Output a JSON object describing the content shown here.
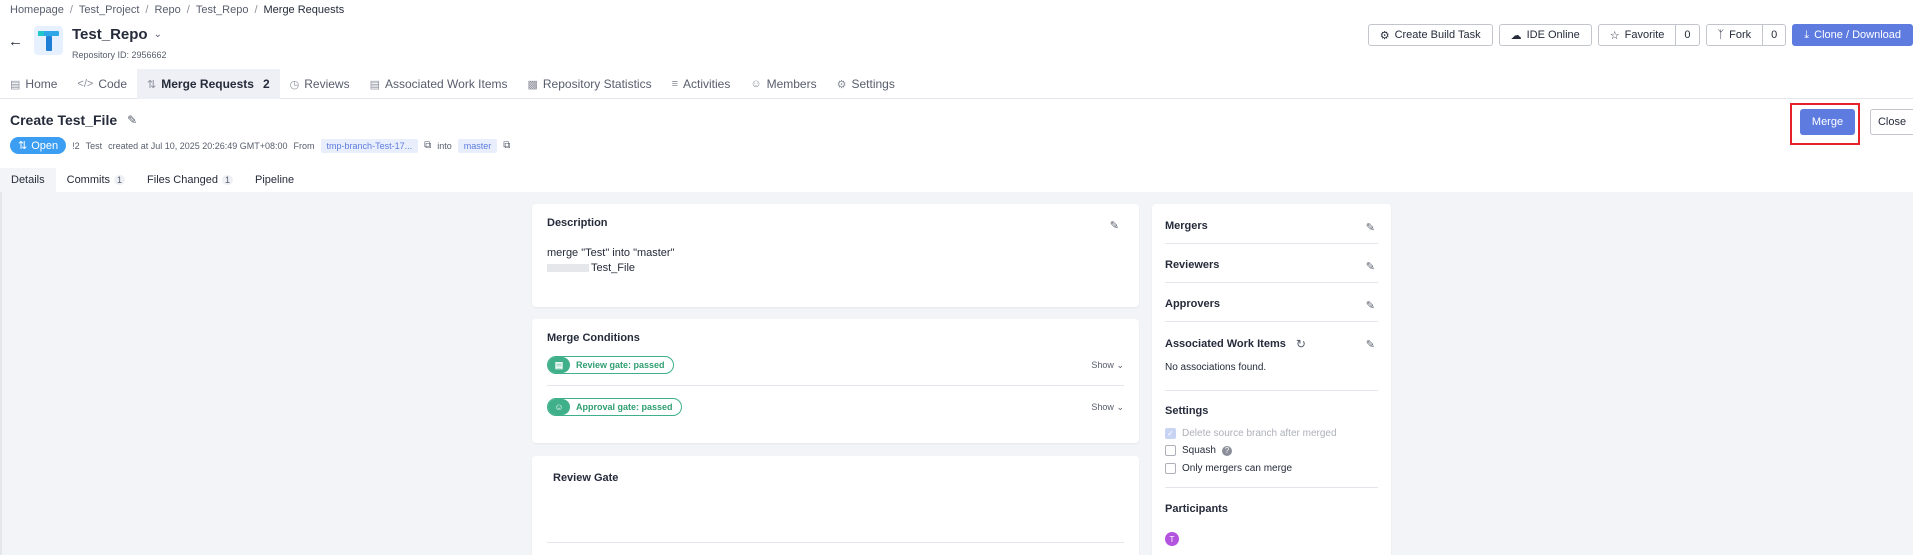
{
  "breadcrumb": {
    "items": [
      "Homepage",
      "Test_Project",
      "Repo",
      "Test_Repo"
    ],
    "separator": "/",
    "current": "Merge Requests"
  },
  "repo": {
    "name": "Test_Repo",
    "id_label": "Repository ID: 2956662"
  },
  "actions": {
    "build_task": "Create Build Task",
    "ide_online": "IDE Online",
    "favorite": "Favorite",
    "favorite_count": "0",
    "fork": "Fork",
    "fork_count": "0",
    "clone": "Clone / Download"
  },
  "nav": {
    "items": [
      {
        "label": "Home",
        "icon": "home-icon"
      },
      {
        "label": "Code",
        "icon": "code-icon"
      },
      {
        "label": "Merge Requests",
        "icon": "merge-request-icon",
        "badge": "2"
      },
      {
        "label": "Reviews",
        "icon": "review-icon"
      },
      {
        "label": "Associated Work Items",
        "icon": "work-item-icon"
      },
      {
        "label": "Repository Statistics",
        "icon": "stats-icon"
      },
      {
        "label": "Activities",
        "icon": "activity-icon"
      },
      {
        "label": "Members",
        "icon": "members-icon"
      },
      {
        "label": "Settings",
        "icon": "settings-icon"
      }
    ]
  },
  "mr": {
    "title": "Create Test_File",
    "status": "Open",
    "number": "!2",
    "author": "Test",
    "created": "created at Jul 10, 2025 20:26:49 GMT+08:00",
    "from_label": "From",
    "source_branch": "tmp-branch-Test-17...",
    "into_label": "into",
    "target_branch": "master",
    "merge_label": "Merge",
    "close_label": "Close"
  },
  "subtabs": [
    {
      "label": "Details"
    },
    {
      "label": "Commits",
      "count": "1"
    },
    {
      "label": "Files Changed",
      "count": "1"
    },
    {
      "label": "Pipeline"
    }
  ],
  "description": {
    "title": "Description",
    "line1": "merge \"Test\" into \"master\"",
    "line2": "Test_File"
  },
  "merge_conditions": {
    "title": "Merge Conditions",
    "gates": [
      {
        "label": "Review gate: passed",
        "show": "Show"
      },
      {
        "label": "Approval gate: passed",
        "show": "Show"
      }
    ]
  },
  "review_gate": {
    "title": "Review Gate"
  },
  "sidebar": {
    "mergers": "Mergers",
    "reviewers": "Reviewers",
    "approvers": "Approvers",
    "work_items": "Associated Work Items",
    "no_associations": "No associations found.",
    "settings": "Settings",
    "options": [
      {
        "label": "Delete source branch after merged",
        "checked": true,
        "disabled": true
      },
      {
        "label": "Squash",
        "checked": false,
        "disabled": false
      },
      {
        "label": "Only mergers can merge",
        "checked": false,
        "disabled": false
      }
    ],
    "participants": "Participants",
    "participant_initial": "T"
  },
  "colors": {
    "primary": "#5e7ce0",
    "open_status": "#3c9ef2",
    "gate_passed": "#3fb08a",
    "highlight_box": "#e6212a",
    "avatar": "#b254de"
  }
}
